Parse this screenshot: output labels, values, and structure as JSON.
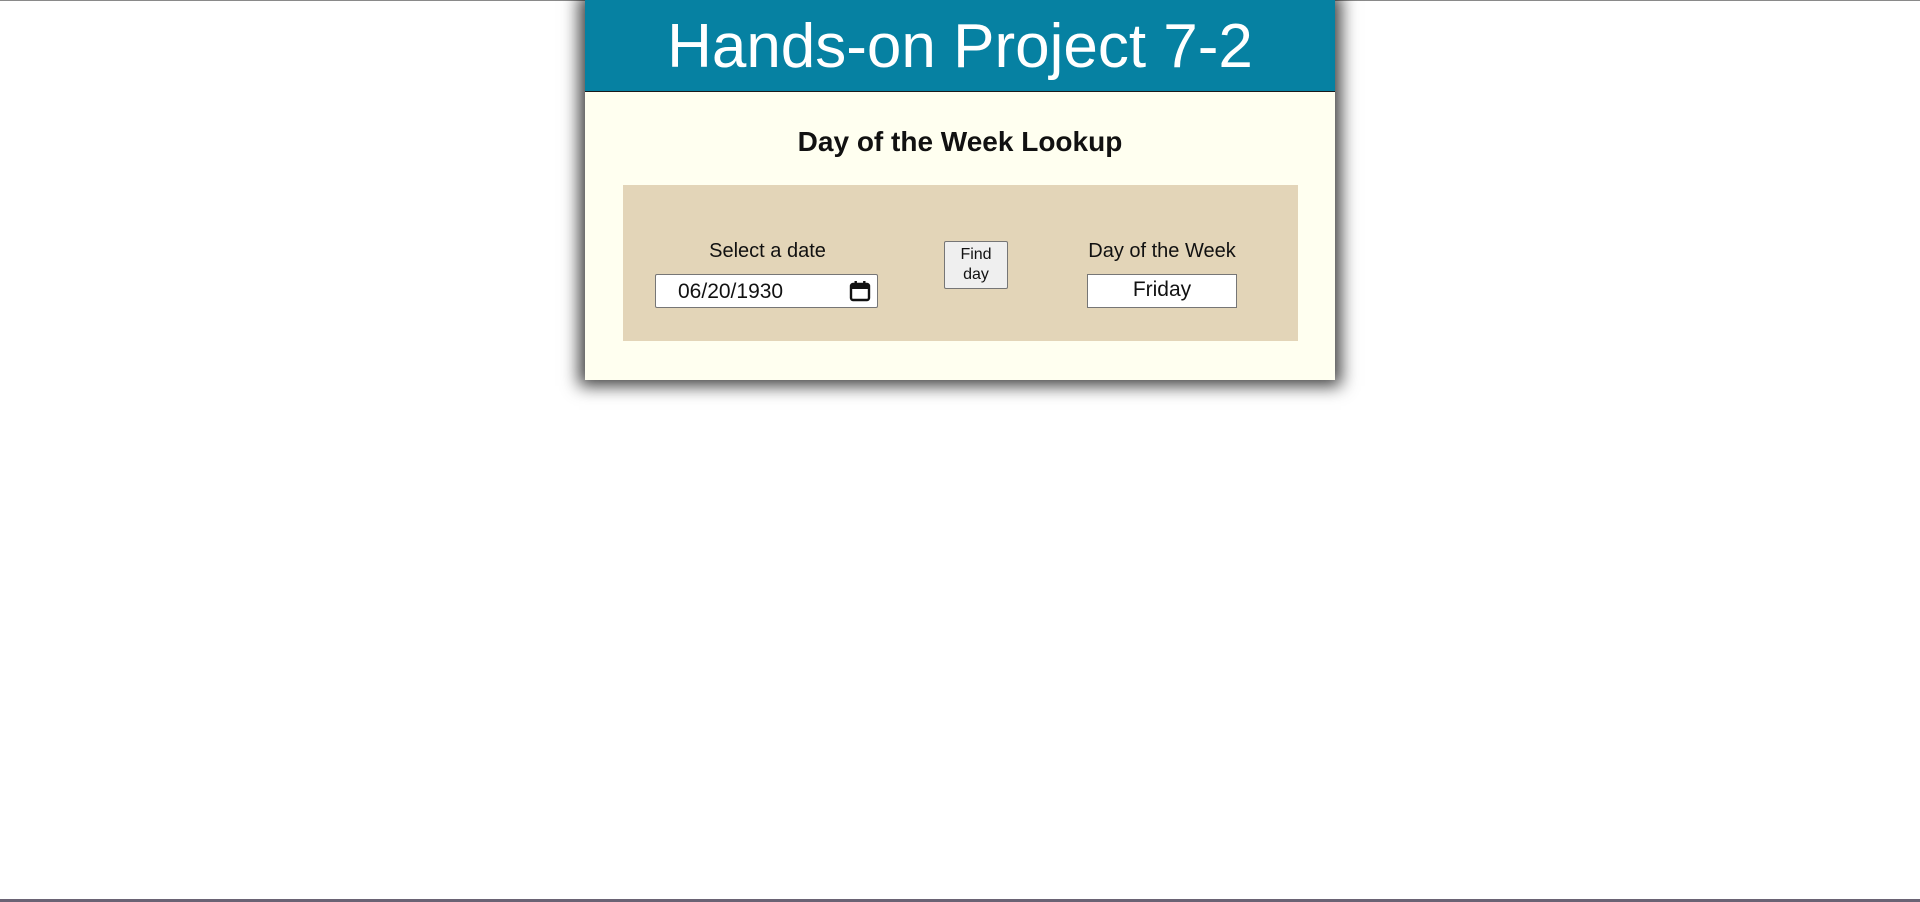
{
  "header": {
    "title": "Hands-on Project 7-2"
  },
  "main": {
    "subtitle": "Day of the Week Lookup",
    "date_field": {
      "label": "Select a date",
      "value": "06/20/1930",
      "icon": "calendar-icon"
    },
    "find_button": {
      "label": "Find day"
    },
    "result_field": {
      "label": "Day of the Week",
      "value": "Friday"
    }
  },
  "colors": {
    "banner": "#0681a2",
    "card_background": "#fffff0",
    "panel_background": "#e3d5b8"
  }
}
